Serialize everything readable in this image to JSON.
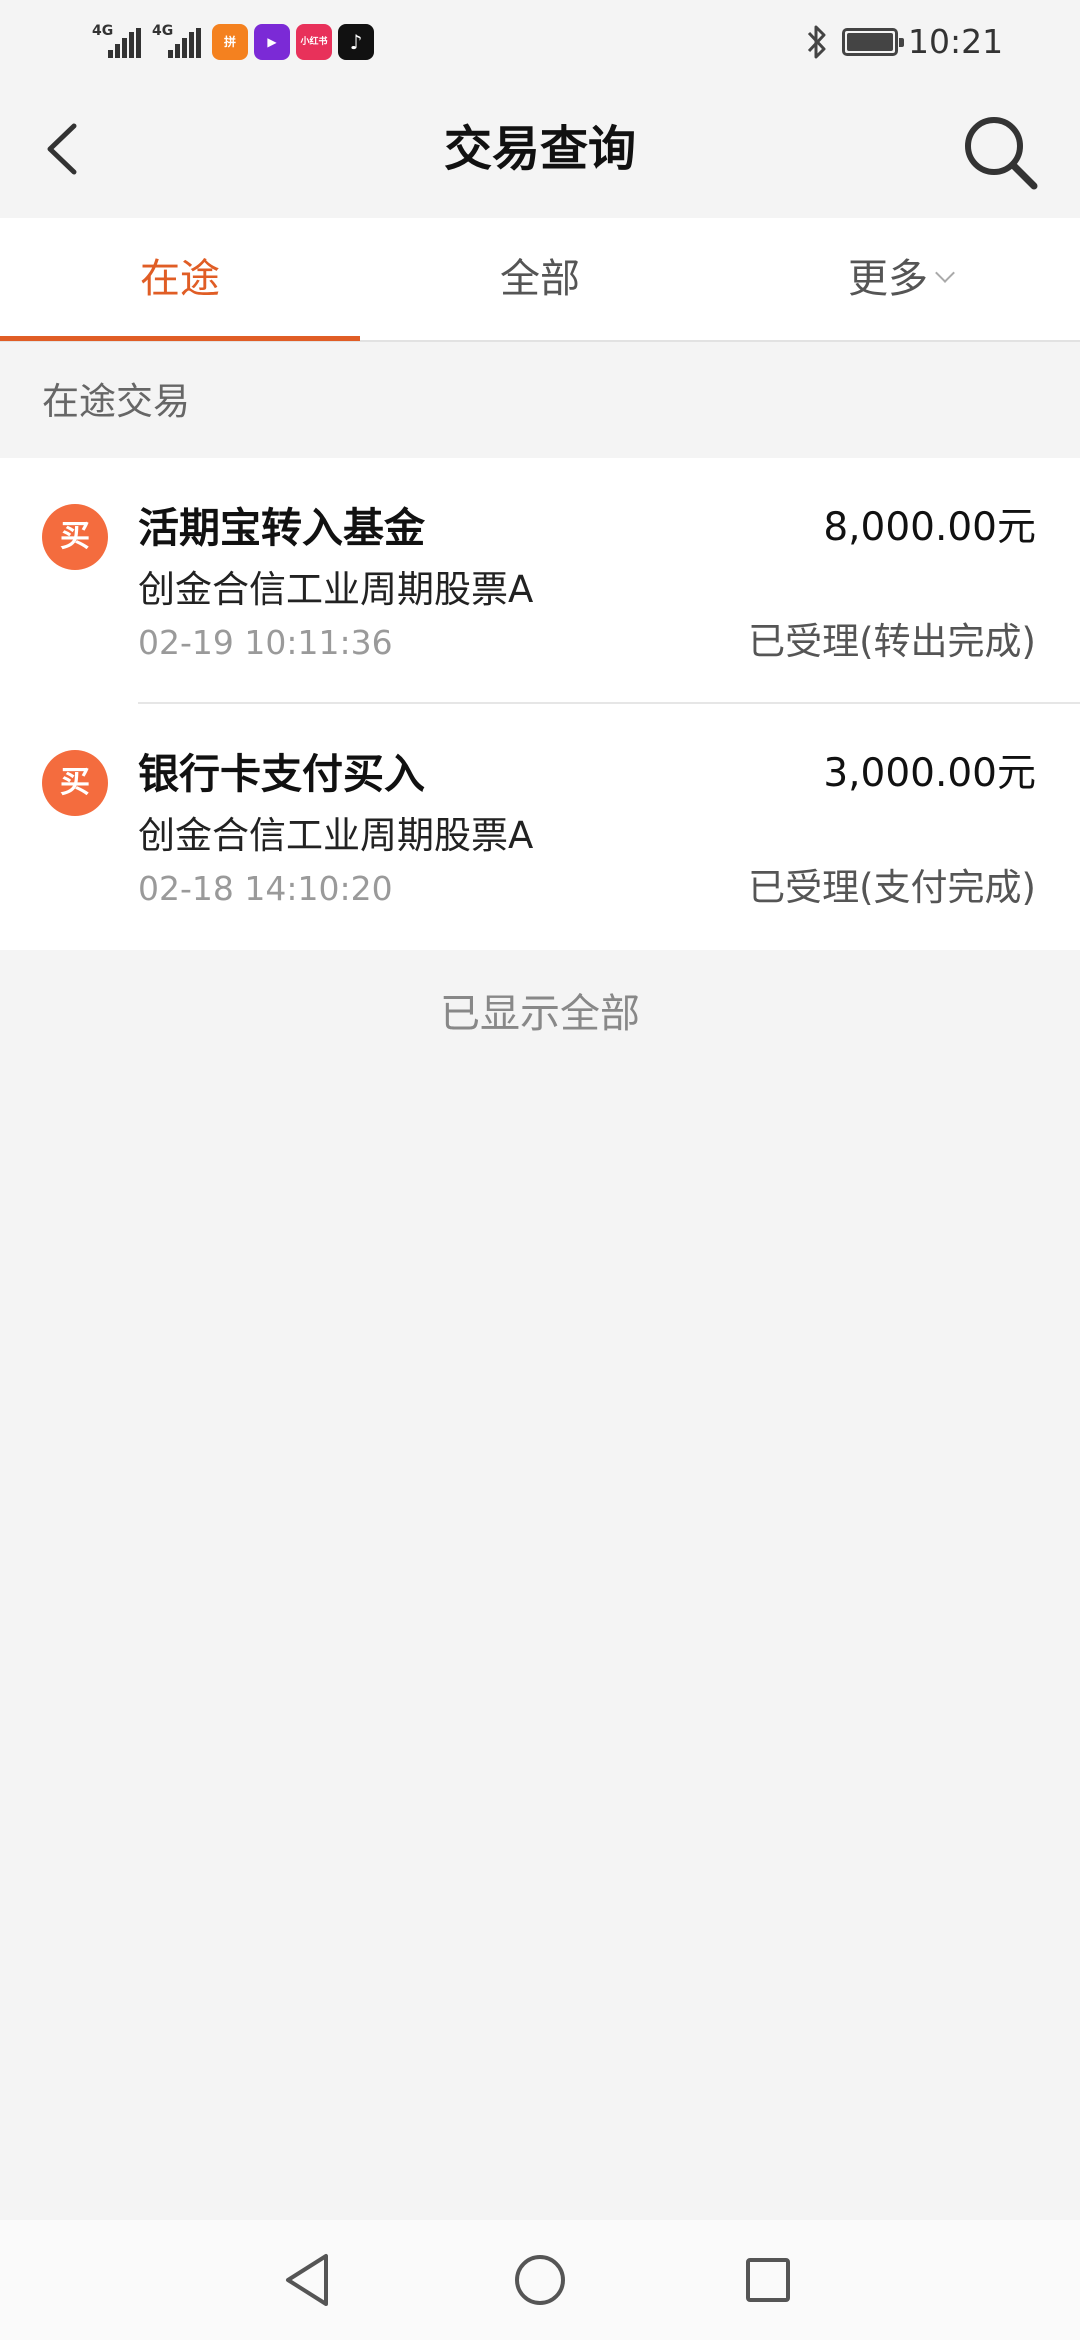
{
  "status_bar": {
    "signal1_label": "4G",
    "signal2_label": "4G",
    "apps": [
      {
        "name": "taobao-app-icon",
        "label": "拼",
        "color": "#f4811f"
      },
      {
        "name": "video-app-icon",
        "label": "▶",
        "color": "#7b2ad6"
      },
      {
        "name": "xiaohongshu-app-icon",
        "label": "小红书",
        "color": "#e8315a"
      },
      {
        "name": "tiktok-app-icon",
        "label": "♪",
        "color": "#111111"
      }
    ],
    "time": "10:21"
  },
  "header": {
    "title": "交易查询"
  },
  "tabs": [
    {
      "label": "在途",
      "active": true
    },
    {
      "label": "全部",
      "active": false
    },
    {
      "label": "更多",
      "active": false
    }
  ],
  "section": {
    "title": "在途交易"
  },
  "transactions": [
    {
      "icon_label": "买",
      "title": "活期宝转入基金",
      "amount": "8,000.00元",
      "fund": "创金合信工业周期股票A",
      "time": "02-19 10:11:36",
      "status": "已受理(转出完成)"
    },
    {
      "icon_label": "买",
      "title": "银行卡支付买入",
      "amount": "3,000.00元",
      "fund": "创金合信工业周期股票A",
      "time": "02-18 14:10:20",
      "status": "已受理(支付完成)"
    }
  ],
  "footer_note": "已显示全部",
  "colors": {
    "accent": "#e05d25",
    "icon_bg": "#f46c3e",
    "background": "#f4f4f4"
  }
}
